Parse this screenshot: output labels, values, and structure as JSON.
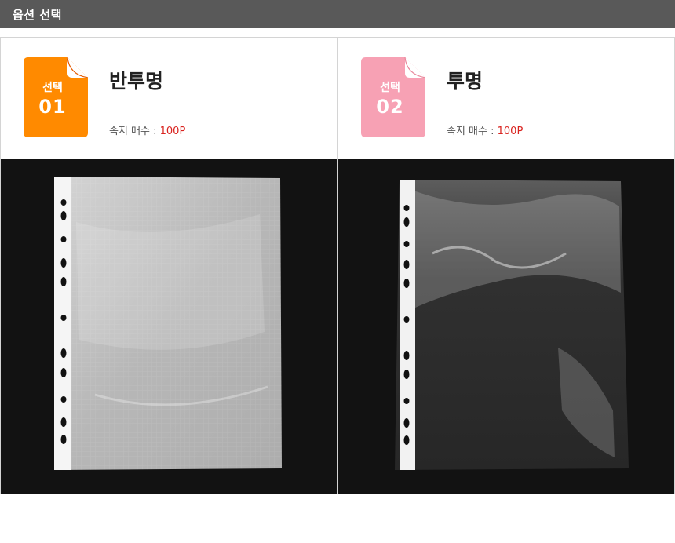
{
  "header": {
    "title": "옵션 선택"
  },
  "options": [
    {
      "badge_label": "선택",
      "badge_number": "01",
      "badge_color": "#ff8a00",
      "name": "반투명",
      "meta_label": "속지 매수 :",
      "meta_value": "100P",
      "image_icon": "semi-transparent-sleeve-photo"
    },
    {
      "badge_label": "선택",
      "badge_number": "02",
      "badge_color": "#f7a1b4",
      "name": "투명",
      "meta_label": "속지 매수 :",
      "meta_value": "100P",
      "image_icon": "transparent-sleeve-photo"
    }
  ],
  "colors": {
    "header_bg": "#595959",
    "price_red": "#d9231f",
    "photo_bg": "#121212"
  }
}
